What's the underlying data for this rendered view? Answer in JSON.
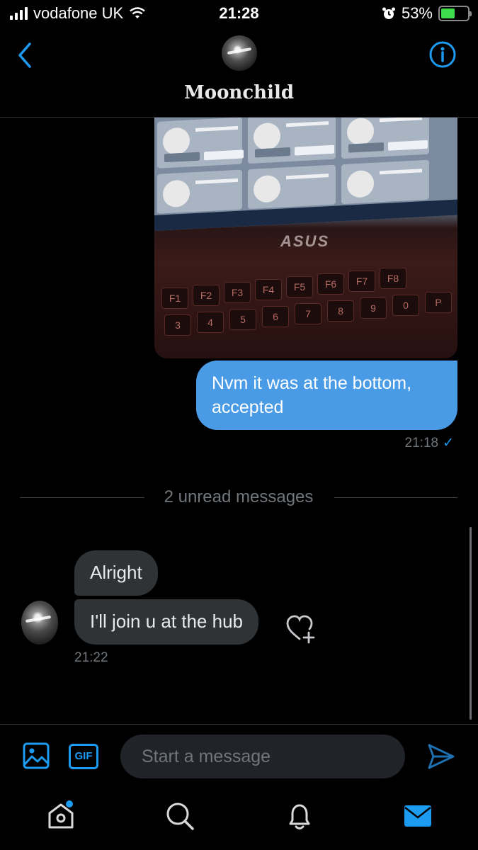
{
  "status_bar": {
    "carrier": "vodafone UK",
    "time": "21:28",
    "battery_percent": "53%",
    "battery_level": 0.53
  },
  "header": {
    "title": "Moonchild"
  },
  "conversation": {
    "outgoing": {
      "text": "Nvm it was at the bottom, accepted",
      "time": "21:18",
      "read_mark": "✓"
    },
    "unread_divider": "2 unread messages",
    "incoming": [
      {
        "text": "Alright"
      },
      {
        "text": "I'll  join u at the hub"
      }
    ],
    "incoming_time": "21:22"
  },
  "photo_text": {
    "cards": [
      "MoMahher",
      "123sansay123",
      "mombanza2",
      "ADGclub",
      "Applezee",
      "flossieanthony"
    ],
    "ignore_label": "Ignore",
    "accept_label": "Accept",
    "brand": "ASUS"
  },
  "composer": {
    "gif_label": "GIF",
    "placeholder": "Start a message"
  },
  "icons": {
    "back": "chevron-left-icon",
    "info": "info-icon",
    "media": "image-icon",
    "send": "send-icon",
    "home": "home-icon",
    "search": "search-icon",
    "notifications": "bell-icon",
    "messages": "mail-icon"
  },
  "colors": {
    "accent": "#1d9bf0",
    "outgoing_bubble": "#4a9be6",
    "incoming_bubble": "#2f3336",
    "background": "#000000"
  }
}
